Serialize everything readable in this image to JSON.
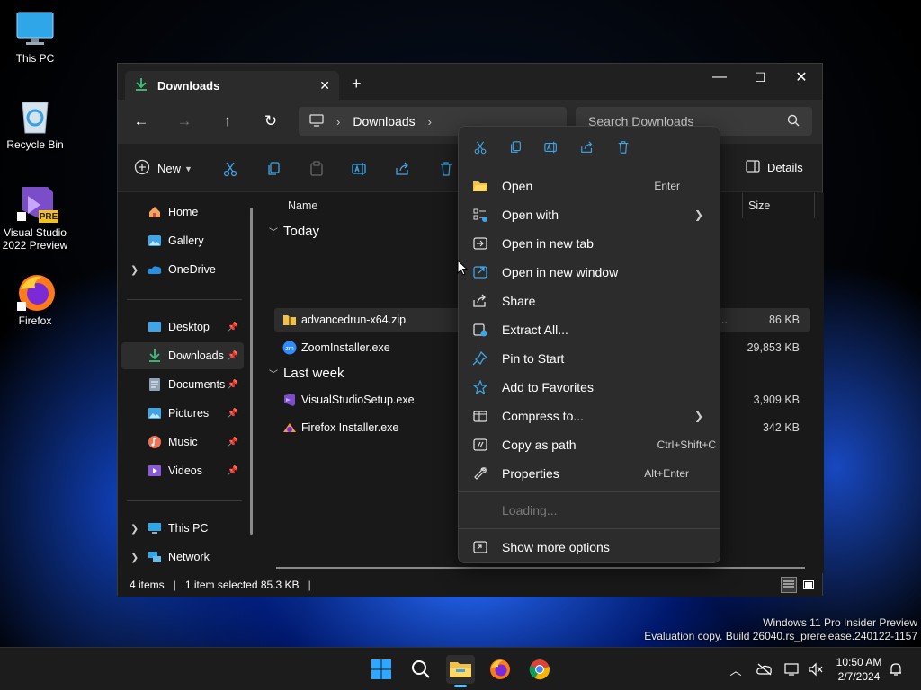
{
  "desktop": {
    "icons": [
      {
        "label": "This PC"
      },
      {
        "label": "Recycle Bin"
      },
      {
        "label": "Visual Studio 2022 Preview",
        "badge": "PRE"
      },
      {
        "label": "Firefox"
      }
    ],
    "watermark": {
      "line1": "Windows 11 Pro Insider Preview",
      "line2": "Evaluation copy. Build 26040.rs_prerelease.240122-1157"
    }
  },
  "window": {
    "tab_title": "Downloads",
    "tab_close": "✕",
    "new_tab": "+",
    "controls": {
      "minimize": "—",
      "maximize": "☐",
      "close": "✕"
    },
    "address": {
      "separator": "›",
      "segment": "Downloads"
    },
    "search": {
      "placeholder": "Search Downloads"
    },
    "toolbar": {
      "new_label": "New",
      "details_label": "Details"
    },
    "sidebar": {
      "items": [
        {
          "label": "Home"
        },
        {
          "label": "Gallery"
        },
        {
          "label": "OneDrive"
        },
        {
          "label": "Desktop"
        },
        {
          "label": "Downloads"
        },
        {
          "label": "Documents"
        },
        {
          "label": "Pictures"
        },
        {
          "label": "Music"
        },
        {
          "label": "Videos"
        },
        {
          "label": "This PC"
        },
        {
          "label": "Network"
        }
      ]
    },
    "columns": {
      "name": "Name",
      "size": "Size"
    },
    "groups": [
      {
        "label": "Today"
      },
      {
        "label": "Last week"
      }
    ],
    "files": [
      {
        "name": "advancedrun-x64.zip",
        "extra": "p...",
        "size": "86 KB"
      },
      {
        "name": "ZoomInstaller.exe",
        "size": "29,853 KB"
      },
      {
        "name": "VisualStudioSetup.exe",
        "size": "3,909 KB"
      },
      {
        "name": "Firefox Installer.exe",
        "size": "342 KB"
      }
    ],
    "status": {
      "items": "4 items",
      "selected": "1 item selected  85.3 KB"
    }
  },
  "context_menu": {
    "items": [
      {
        "label": "Open",
        "shortcut": "Enter"
      },
      {
        "label": "Open with"
      },
      {
        "label": "Open in new tab"
      },
      {
        "label": "Open in new window"
      },
      {
        "label": "Share"
      },
      {
        "label": "Extract All..."
      },
      {
        "label": "Pin to Start"
      },
      {
        "label": "Add to Favorites"
      },
      {
        "label": "Compress to..."
      },
      {
        "label": "Copy as path",
        "shortcut": "Ctrl+Shift+C"
      },
      {
        "label": "Properties",
        "shortcut": "Alt+Enter"
      }
    ],
    "loading": "Loading...",
    "more": "Show more options"
  },
  "taskbar": {
    "time": "10:50 AM",
    "date": "2/7/2024"
  },
  "colors": {
    "accent": "#4cc2ff",
    "folder": "#f0c24b",
    "window_bg": "#191919",
    "menu_bg": "#2c2c2c"
  }
}
